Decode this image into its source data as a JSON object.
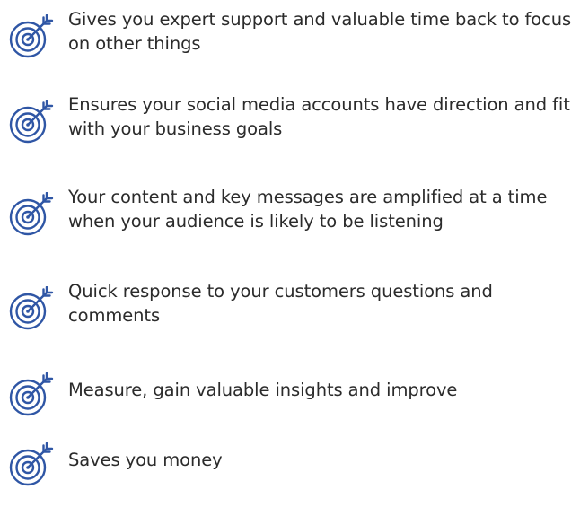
{
  "icon_name": "target-arrow-icon",
  "icon_color": "#2f56a5",
  "text_color": "#2b2b2b",
  "benefits": [
    {
      "text": "Gives you expert support and valuable time back to focus on other things"
    },
    {
      "text": "Ensures your social media accounts have direction and fit with your business goals"
    },
    {
      "text": "Your content and key messages are amplified at a time when your audience is likely to be listening"
    },
    {
      "text": "Quick response to your customers questions and comments"
    },
    {
      "text": "Measure, gain valuable insights and improve"
    },
    {
      "text": "Saves you money"
    }
  ]
}
